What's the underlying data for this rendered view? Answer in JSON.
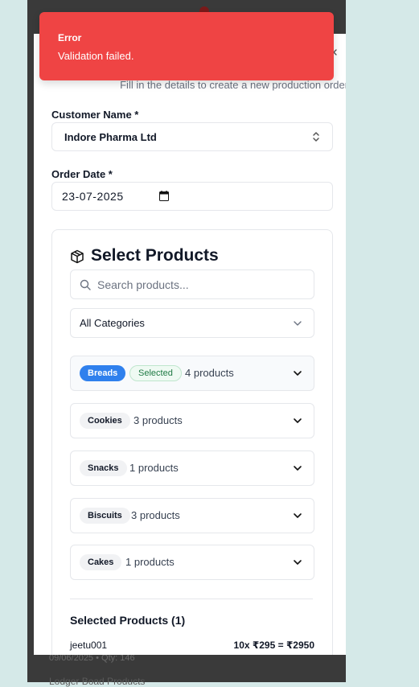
{
  "background": {
    "footer_text": "09/06/2025 • Qty: 146",
    "footer_text2": "Lodger Boad Products"
  },
  "toast": {
    "title": "Error",
    "message": "Validation failed."
  },
  "modal": {
    "subtitle": "Fill in the details to create a new production order.",
    "close_icon": "close-icon",
    "customer": {
      "label": "Customer Name *",
      "value": "Indore Pharma Ltd"
    },
    "order_date": {
      "label": "Order Date *",
      "value": "23-07-2025"
    },
    "products": {
      "title": "Select Products",
      "search_placeholder": "Search products...",
      "category_value": "All Categories",
      "groups": [
        {
          "name": "Breads",
          "badge": "Selected",
          "count": "4 products",
          "active": true
        },
        {
          "name": "Cookies",
          "count": "3 products"
        },
        {
          "name": "Snacks",
          "count": "1 products"
        },
        {
          "name": "Biscuits",
          "count": "3 products"
        },
        {
          "name": "Cakes",
          "count": "1 products"
        }
      ],
      "selected_title": "Selected Products (1)",
      "selected_items": [
        {
          "name": "jeetu001",
          "price": "10x ₹295 = ₹2950"
        }
      ]
    }
  },
  "colors": {
    "toast": "#ef4444",
    "pill_blue": "#2f80ed",
    "pill_green_text": "#1f7a44"
  }
}
